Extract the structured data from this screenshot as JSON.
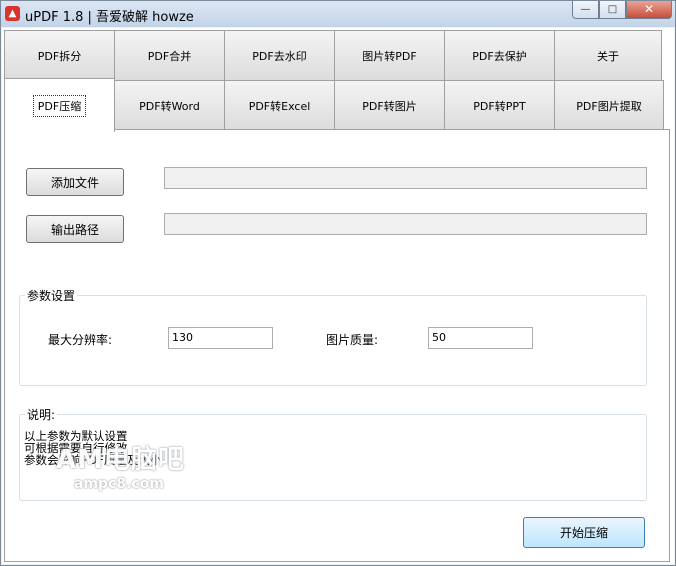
{
  "window": {
    "title": "uPDF 1.8 |  吾爱破解 howze",
    "controls": {
      "minimize": "—",
      "maximize": "□",
      "close": "✕"
    }
  },
  "tabs": {
    "row1": [
      "PDF拆分",
      "PDF合并",
      "PDF去水印",
      "图片转PDF",
      "PDF去保护",
      "关于"
    ],
    "row2": [
      "PDF压缩",
      "PDF转Word",
      "PDF转Excel",
      "PDF转图片",
      "PDF转PPT",
      "PDF图片提取"
    ],
    "active": "PDF压缩"
  },
  "file_section": {
    "add_file_button": "添加文件",
    "add_file_path": "",
    "output_path_button": "输出路径",
    "output_path": ""
  },
  "params": {
    "group_title": "参数设置",
    "max_resolution_label": "最大分辨率:",
    "max_resolution_value": "130",
    "image_quality_label": "图片质量:",
    "image_quality_value": "50"
  },
  "notes": {
    "group_title": "说明:",
    "lines": [
      "以上参数为默认设置",
      "可根据需要自行修改",
      "参数会影响PDF质量及大小"
    ]
  },
  "actions": {
    "start_button": "开始压缩"
  },
  "watermark": {
    "brand": "AM电脑吧",
    "url": "ampc8.com"
  },
  "colors": {
    "accent_button": "#bee6fd",
    "title_bar": "#c3d4e8",
    "close_button": "#c74d3a"
  }
}
